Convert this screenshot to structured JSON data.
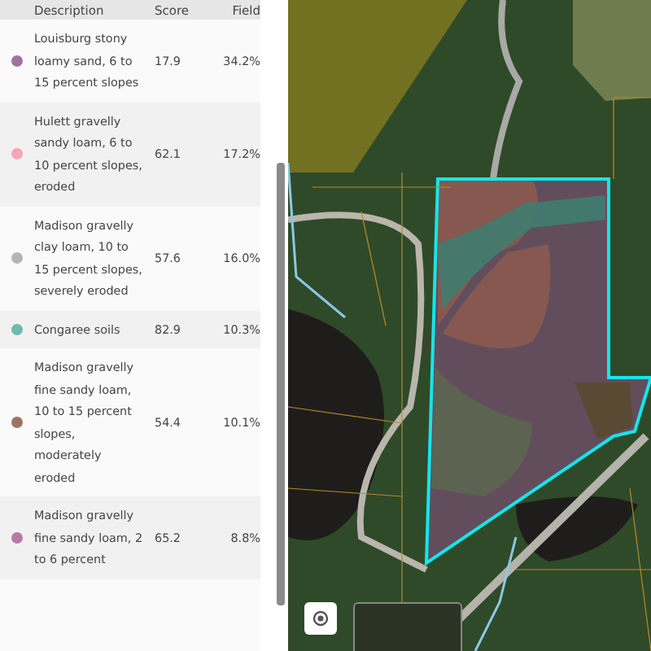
{
  "table": {
    "columns": [
      "Description",
      "Score",
      "Field"
    ],
    "rows": [
      {
        "color": "#a0739c",
        "description": "Louisburg stony loamy sand, 6 to 15 percent slopes",
        "score": "17.9",
        "field": "34.2%"
      },
      {
        "color": "#f4a6b4",
        "description": "Hulett gravelly sandy loam, 6 to 10 percent slopes, eroded",
        "score": "62.1",
        "field": "17.2%"
      },
      {
        "color": "#b8b5b0",
        "description": "Madison gravelly clay loam, 10 to 15 percent slopes, severely eroded",
        "score": "57.6",
        "field": "16.0%"
      },
      {
        "color": "#6fb9b0",
        "description": "Congaree soils",
        "score": "82.9",
        "field": "10.3%"
      },
      {
        "color": "#9a7563",
        "description": "Madison gravelly fine sandy loam, 10 to 15 percent slopes, moderately eroded",
        "score": "54.4",
        "field": "10.1%"
      },
      {
        "color": "#b77aa8",
        "description": "Madison gravelly fine sandy loam, 2 to 6 percent",
        "score": "65.2",
        "field": "8.8%"
      }
    ]
  }
}
